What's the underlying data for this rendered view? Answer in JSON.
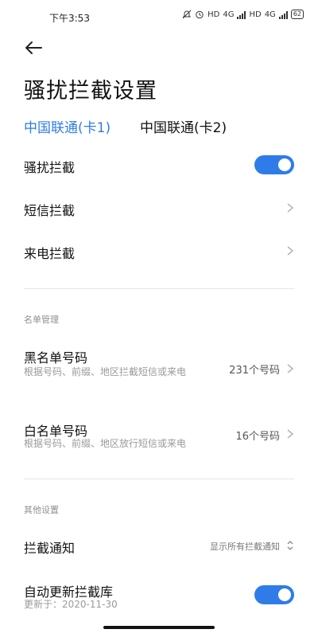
{
  "status_bar": {
    "time": "下午3:53",
    "battery": "62",
    "hd_label": "HD",
    "network_label": "4G"
  },
  "page_title": "骚扰拦截设置",
  "tabs": [
    {
      "label": "中国联通(卡1)",
      "active": true
    },
    {
      "label": "中国联通(卡2)",
      "active": false
    }
  ],
  "settings": {
    "harassment_block": {
      "label": "骚扰拦截",
      "enabled": true
    },
    "sms_block": {
      "label": "短信拦截"
    },
    "call_block": {
      "label": "来电拦截"
    }
  },
  "list_management": {
    "section_title": "名单管理",
    "blacklist": {
      "label": "黑名单号码",
      "description": "根据号码、前缀、地区拦截短信或来电",
      "count": "231个号码"
    },
    "whitelist": {
      "label": "白名单号码",
      "description": "根据号码、前缀、地区放行短信或来电",
      "count": "16个号码"
    }
  },
  "other_settings": {
    "section_title": "其他设置",
    "block_notification": {
      "label": "拦截通知",
      "value": "显示所有拦截通知"
    },
    "auto_update": {
      "label": "自动更新拦截库",
      "updated": "更新于：2020-11-30",
      "enabled": true
    }
  },
  "colors": {
    "accent": "#2f7ce8",
    "text_primary": "#111111",
    "text_secondary": "#9a9a9a"
  },
  "icons": [
    "back-arrow-icon",
    "chevron-right-icon",
    "up-down-chevron-icon",
    "toggle-switch"
  ]
}
